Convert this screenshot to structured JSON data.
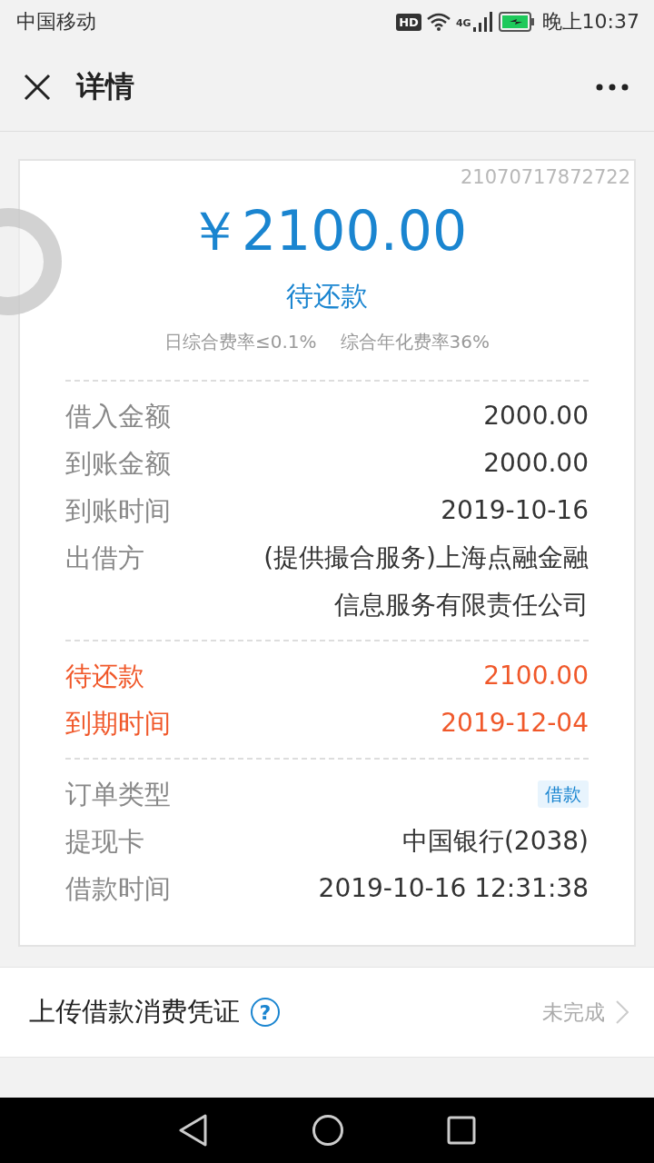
{
  "status_bar": {
    "carrier": "中国移动",
    "hd": "HD",
    "network": "4G",
    "time": "晚上10:37"
  },
  "header": {
    "title": "详情"
  },
  "card": {
    "order_number": "21070717872722",
    "amount": "￥2100.00",
    "status": "待还款",
    "rates": [
      "日综合费率≤0.1%",
      "综合年化费率36%"
    ],
    "sections": [
      {
        "rows": [
          {
            "kind": "plain",
            "label": "借入金额",
            "value": "2000.00"
          },
          {
            "kind": "plain",
            "label": "到账金额",
            "value": "2000.00"
          },
          {
            "kind": "plain",
            "label": "到账时间",
            "value": "2019-10-16"
          },
          {
            "kind": "plain",
            "label": "出借方",
            "value": "(提供撮合服务)上海点融金融信息服务有限责任公司"
          }
        ]
      },
      {
        "rows": [
          {
            "kind": "alert",
            "label": "待还款",
            "value": "2100.00"
          },
          {
            "kind": "alert",
            "label": "到期时间",
            "value": "2019-12-04"
          }
        ]
      },
      {
        "rows": [
          {
            "kind": "tag",
            "label": "订单类型",
            "value": "借款"
          },
          {
            "kind": "plain",
            "label": "提现卡",
            "value": "中国银行(2038)"
          },
          {
            "kind": "plain",
            "label": "借款时间",
            "value": "2019-10-16 12:31:38"
          }
        ]
      }
    ]
  },
  "upload": {
    "label": "上传借款消费凭证",
    "help": "?",
    "state": "未完成"
  }
}
